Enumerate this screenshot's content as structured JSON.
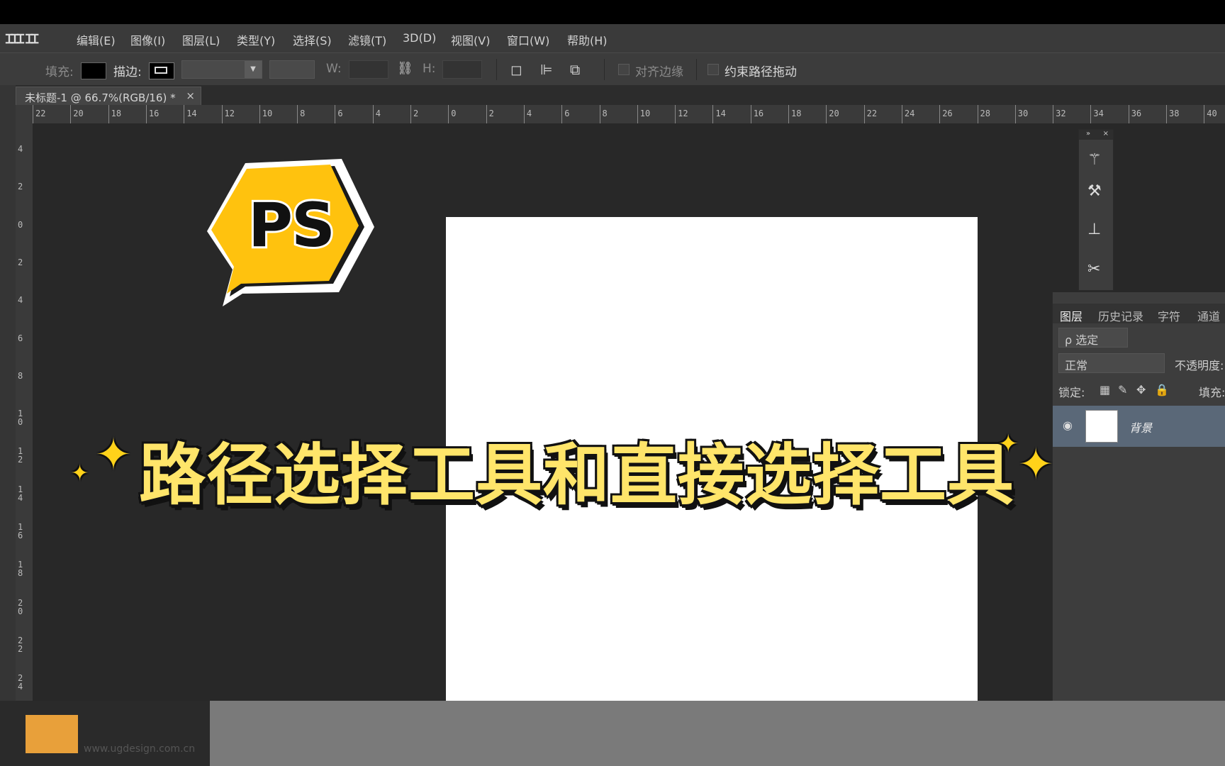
{
  "app": {
    "logo_text": "ꞮꞮꞮ ꞮꞮ",
    "menus": [
      "编辑(E)",
      "图像(I)",
      "图层(L)",
      "类型(Y)",
      "选择(S)",
      "滤镜(T)",
      "3D(D)",
      "视图(V)",
      "窗口(W)",
      "帮助(H)"
    ]
  },
  "options_bar": {
    "fill_label": "填充:",
    "stroke_label": "描边:",
    "w_label": "W:",
    "h_label": "H:",
    "link_icon": "link-icon",
    "align_edges_label": "对齐边缘",
    "constrain_label": "约束路径拖动"
  },
  "document_tab": {
    "title": "未标题-1 @ 66.7%(RGB/16) *",
    "close": "×"
  },
  "rulers": {
    "horizontal": [
      "22",
      "20",
      "18",
      "16",
      "14",
      "12",
      "10",
      "8",
      "6",
      "4",
      "2",
      "0",
      "2",
      "4",
      "6",
      "8",
      "10",
      "12",
      "14",
      "16",
      "18",
      "20",
      "22",
      "24",
      "26",
      "28",
      "30",
      "32",
      "34",
      "36",
      "38",
      "40"
    ],
    "vertical": [
      "4",
      "2",
      "0",
      "2",
      "4",
      "6",
      "8",
      "10",
      "12",
      "14",
      "16",
      "18",
      "20",
      "22",
      "24"
    ]
  },
  "tools_panel": {
    "collapse": "»",
    "close": "×",
    "icons": [
      "brush-presets-icon",
      "tool-presets-icon",
      "clone-source-icon",
      "tools-icon"
    ]
  },
  "layers_panel": {
    "tabs": [
      "图层",
      "历史记录",
      "字符",
      "通道"
    ],
    "filter_label": "ρ 选定",
    "blend_mode": "正常",
    "opacity_label": "不透明度:",
    "lock_label": "锁定:",
    "fill_label": "填充:",
    "layer_name": "背景"
  },
  "overlay": {
    "badge_text": "PS",
    "banner_text": "路径选择工具和直接选择工具",
    "sparkle": "✦"
  },
  "watermark": {
    "url": "www.ugdesign.com.cn"
  },
  "colors": {
    "badge_yellow": "#ffc20e",
    "banner_yellow": "#ffe56a",
    "canvas_bg": "#282828",
    "layer_selected": "#5a6878"
  }
}
